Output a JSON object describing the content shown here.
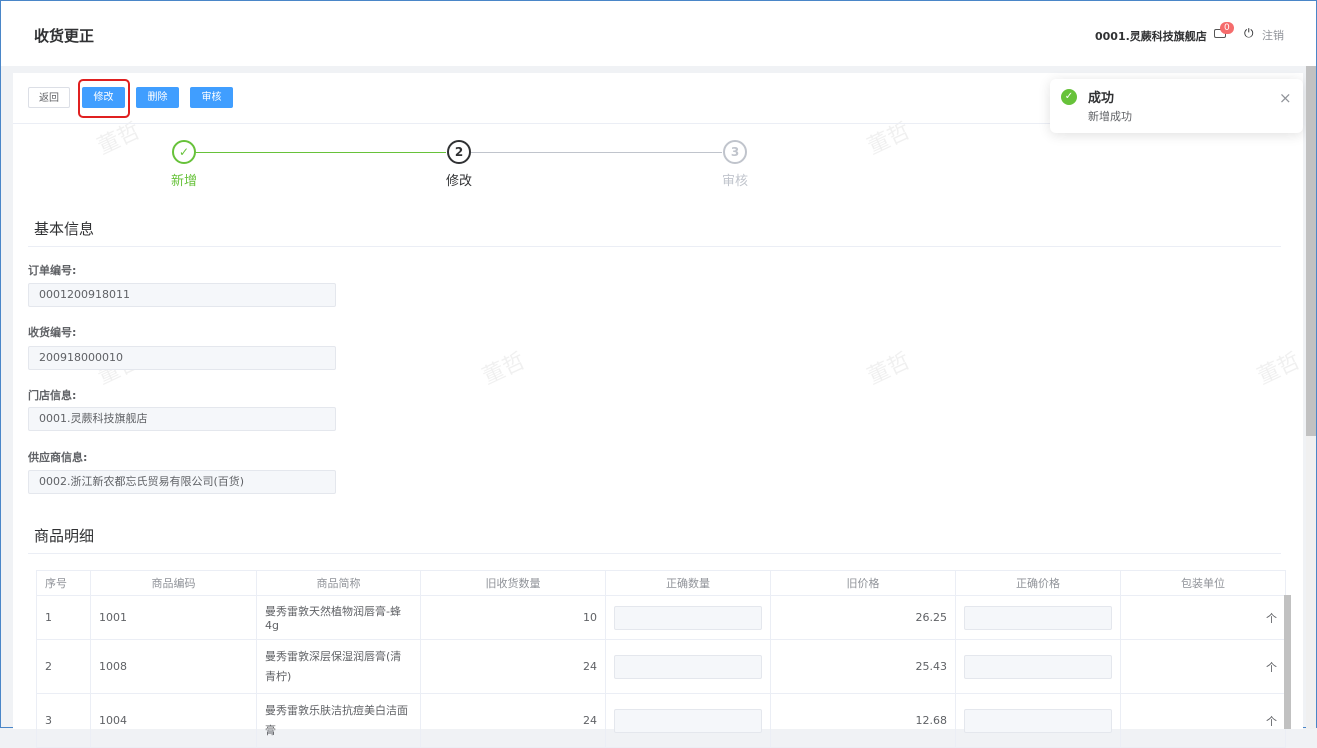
{
  "header": {
    "title": "收货更正",
    "store": "0001.灵蕨科技旗舰店",
    "badge": "0",
    "logout": "注销"
  },
  "toolbar": {
    "back": "返回",
    "edit": "修改",
    "delete": "删除",
    "audit": "审核"
  },
  "steps": [
    {
      "num": "✓",
      "label": "新增",
      "state": "done"
    },
    {
      "num": "2",
      "label": "修改",
      "state": "active"
    },
    {
      "num": "3",
      "label": "审核",
      "state": "pending"
    }
  ],
  "basic": {
    "title": "基本信息",
    "fields": [
      {
        "label": "订单编号:",
        "value": "0001200918011"
      },
      {
        "label": "收货编号:",
        "value": "200918000010"
      },
      {
        "label": "门店信息:",
        "value": "0001.灵蕨科技旗舰店"
      },
      {
        "label": "供应商信息:",
        "value": "0002.浙江新农都忘氏贸易有限公司(百货)"
      }
    ]
  },
  "detail": {
    "title": "商品明细",
    "columns": [
      "序号",
      "商品编码",
      "商品简称",
      "旧收货数量",
      "正确数量",
      "旧价格",
      "正确价格",
      "包装单位"
    ],
    "rows": [
      {
        "no": "1",
        "code": "1001",
        "name": "曼秀雷敦天然植物润唇膏-蜂4g",
        "qty": "10",
        "price": "26.25",
        "unit": "个"
      },
      {
        "no": "2",
        "code": "1008",
        "name": "曼秀雷敦深层保湿润唇膏(清青柠)",
        "qty": "24",
        "price": "25.43",
        "unit": "个"
      },
      {
        "no": "3",
        "code": "1004",
        "name": "曼秀雷敦乐肤洁抗痘美白洁面膏",
        "qty": "24",
        "price": "12.68",
        "unit": "个"
      }
    ]
  },
  "toast": {
    "title": "成功",
    "message": "新增成功",
    "close": "×"
  },
  "watermark": "董哲"
}
